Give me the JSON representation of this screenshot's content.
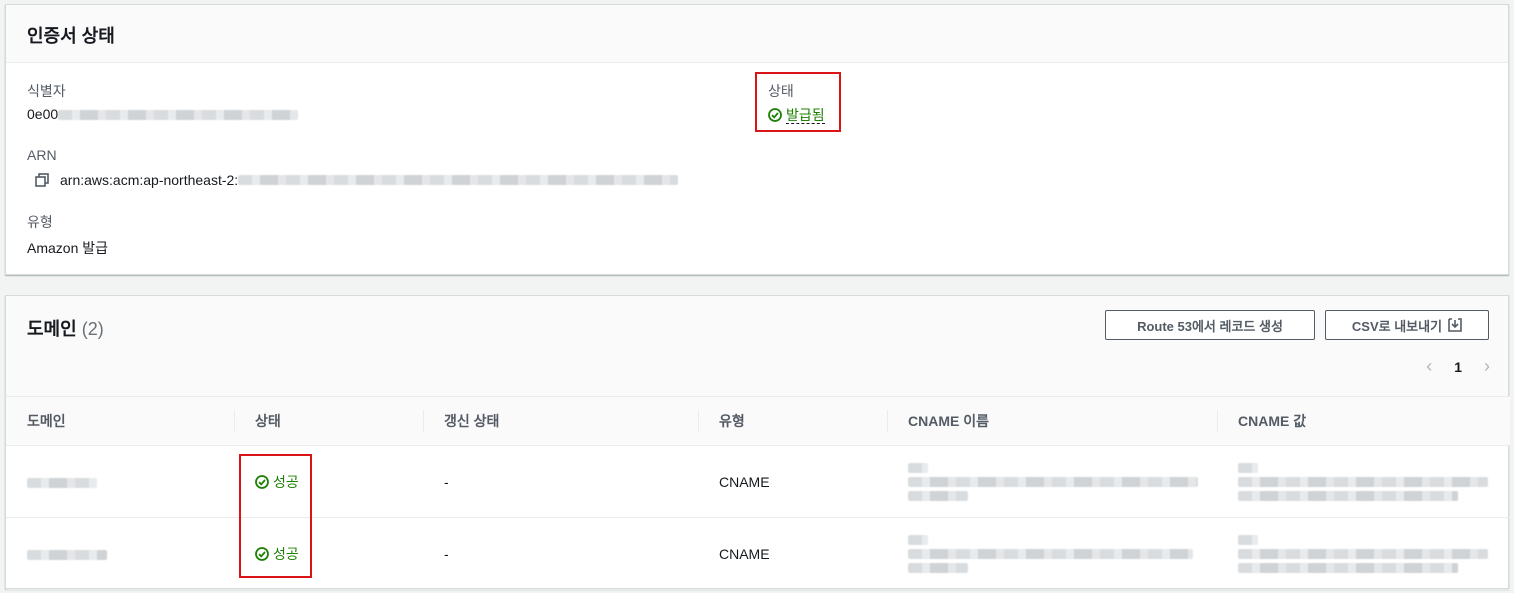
{
  "certificate_status": {
    "title": "인증서 상태",
    "identifier_label": "식별자",
    "identifier_value": "0e00",
    "status_label": "상태",
    "status_value": "발급됨",
    "arn_label": "ARN",
    "arn_value": "arn:aws:acm:ap-northeast-2:",
    "type_label": "유형",
    "type_value": "Amazon 발급"
  },
  "domains": {
    "title": "도메인",
    "count": "(2)",
    "route53_button": "Route 53에서 레코드 생성",
    "csv_button": "CSV로 내보내기",
    "page": "1",
    "columns": [
      "도메인",
      "상태",
      "갱신 상태",
      "유형",
      "CNAME 이름",
      "CNAME 값"
    ],
    "rows": [
      {
        "status": "성공",
        "renewal": "-",
        "type": "CNAME"
      },
      {
        "status": "성공",
        "renewal": "-",
        "type": "CNAME"
      }
    ]
  },
  "colors": {
    "success": "#1d8102",
    "highlight": "#d91515",
    "accent": "#545b64"
  },
  "icons": [
    "copy-icon",
    "success-check-icon",
    "download-icon",
    "chevron-left-icon",
    "chevron-right-icon"
  ]
}
